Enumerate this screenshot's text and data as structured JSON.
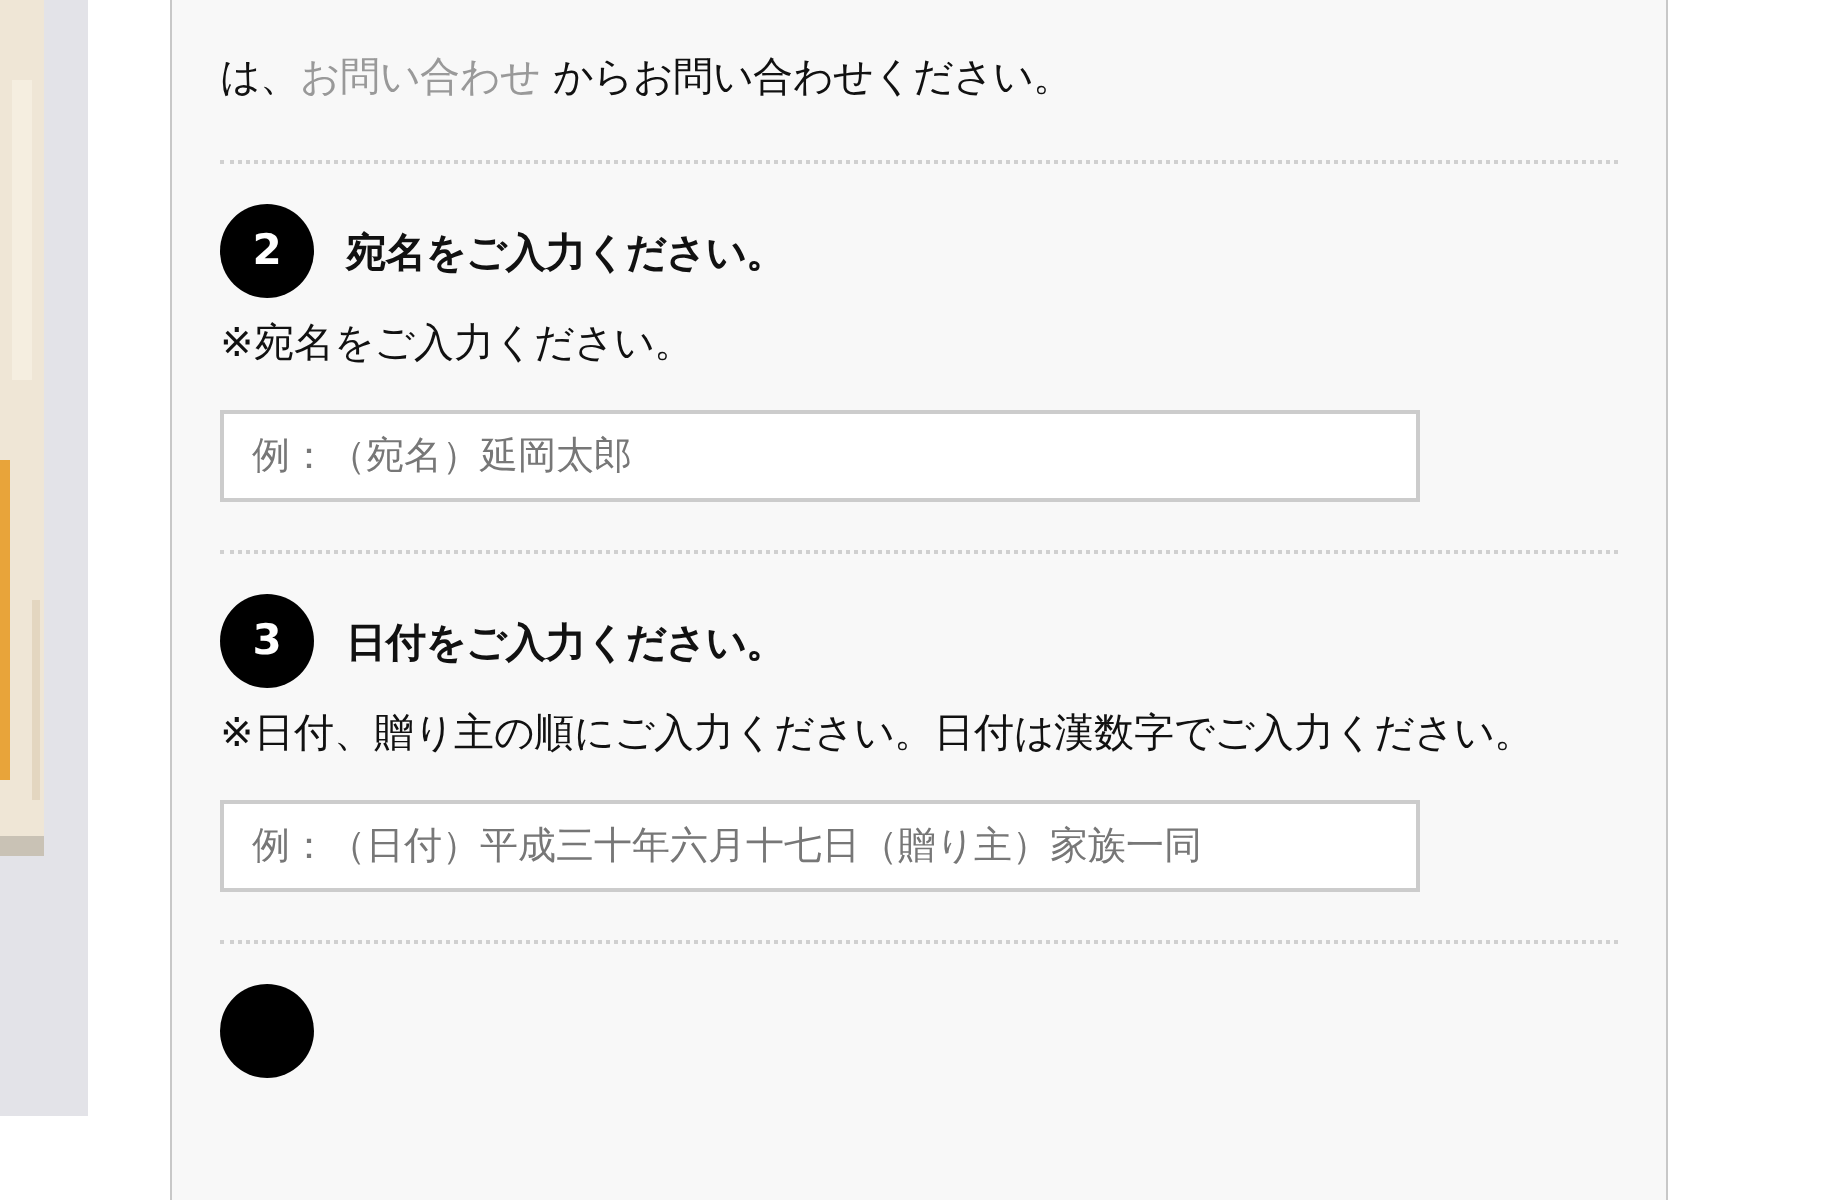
{
  "intro": {
    "before": "は、",
    "link": "お問い合わせ",
    "after": " からお問い合わせください。"
  },
  "steps": [
    {
      "kind": "field",
      "number": "2",
      "heading": "宛名をご入力ください。",
      "note": "※宛名をご入力ください。",
      "placeholder": "例：（宛名）延岡太郎"
    },
    {
      "kind": "field",
      "number": "3",
      "heading": "日付をご入力ください。",
      "note": "※日付、贈り主の順にご入力ください。日付は漢数字でご入力ください。",
      "placeholder": "例：（日付）平成三十年六月十七日（贈り主）家族一同"
    },
    {
      "kind": "marker"
    }
  ]
}
